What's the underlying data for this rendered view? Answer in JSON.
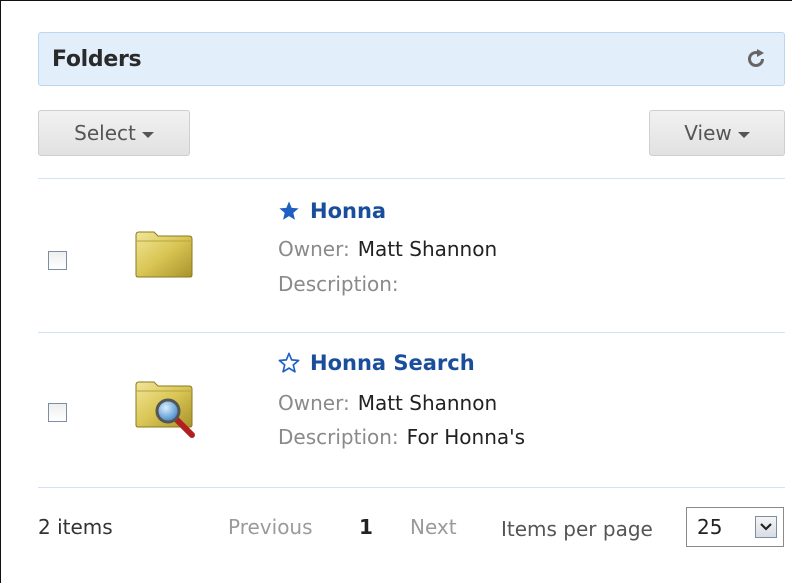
{
  "panel": {
    "title": "Folders"
  },
  "toolbar": {
    "select_label": "Select",
    "view_label": "View"
  },
  "labels": {
    "owner": "Owner:",
    "description": "Description:"
  },
  "items": [
    {
      "name": "Honna",
      "starred": true,
      "icon": "folder-icon",
      "owner": "Matt Shannon",
      "description": ""
    },
    {
      "name": "Honna Search",
      "starred": false,
      "icon": "search-folder-icon",
      "owner": "Matt Shannon",
      "description": "For Honna's"
    }
  ],
  "footer": {
    "count": "2 items",
    "previous": "Previous",
    "page": "1",
    "next": "Next",
    "items_per_page_label": "Items per page",
    "items_per_page": "25"
  },
  "colors": {
    "accent": "#1a4e9c",
    "header_bg": "#e3eefb"
  }
}
